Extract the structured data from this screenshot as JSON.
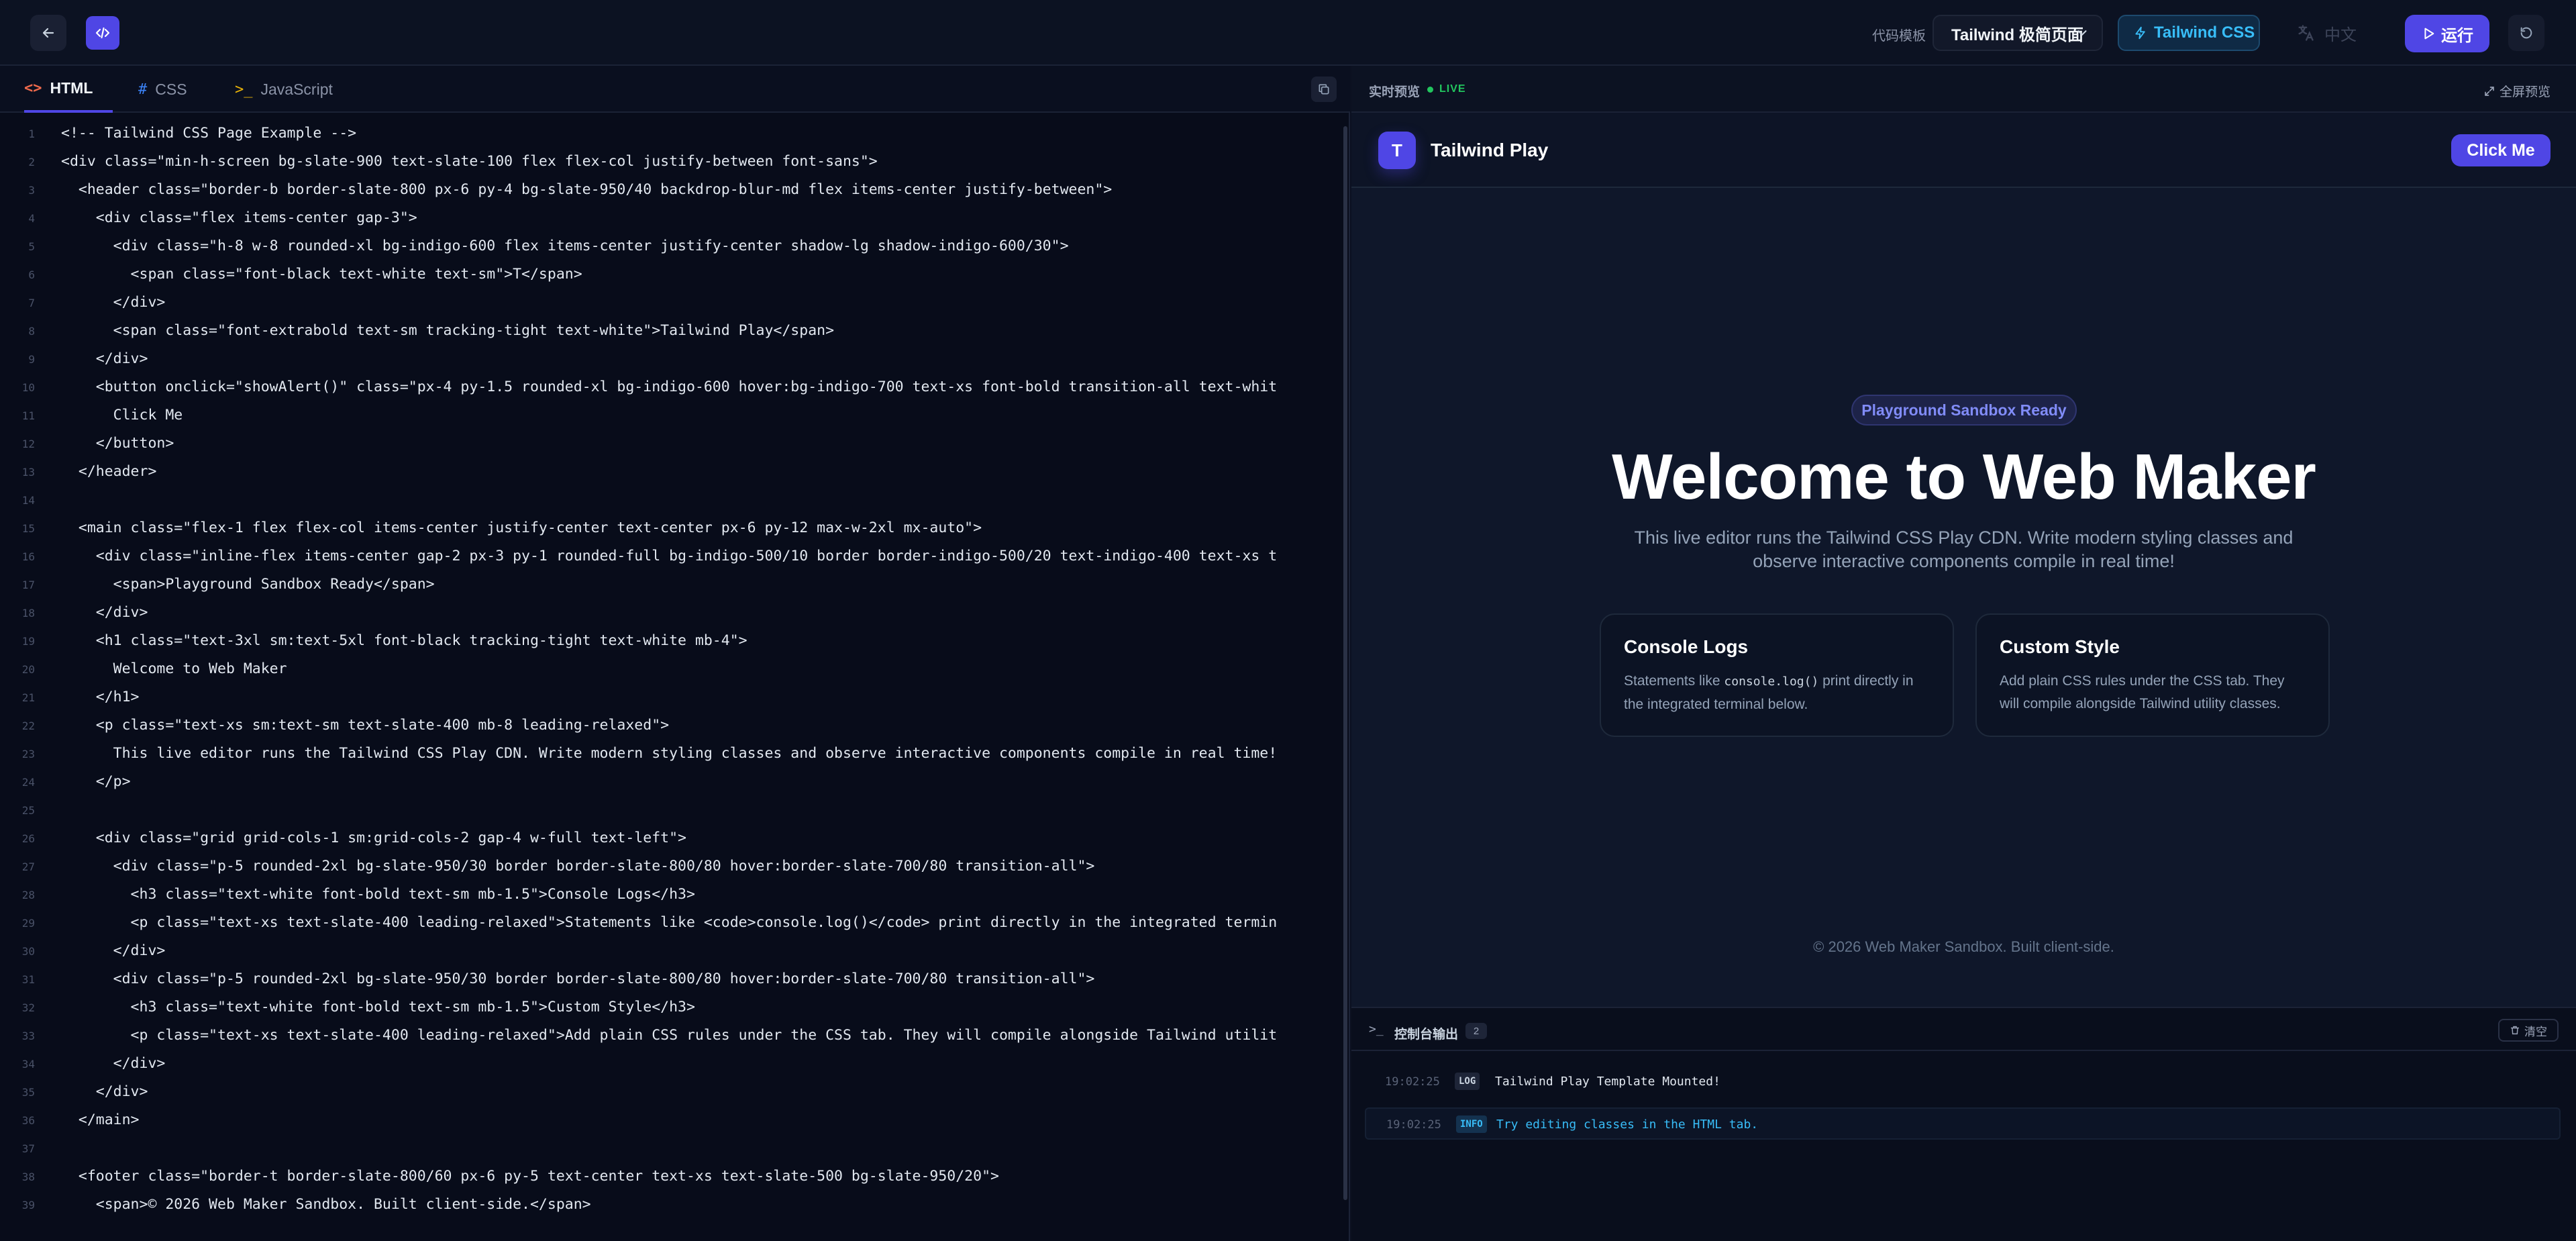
{
  "topbar": {
    "template_label": "代码模板",
    "template_value": "Tailwind 极简页面",
    "tailwind_badge": "Tailwind CSS",
    "language": "中文",
    "run_label": "运行"
  },
  "editor": {
    "tabs": [
      {
        "icon": "<>",
        "label": "HTML"
      },
      {
        "icon": "#",
        "label": "CSS"
      },
      {
        "icon": ">_",
        "label": "JavaScript"
      }
    ],
    "lines": [
      "<!-- Tailwind CSS Page Example -->",
      "<div class=\"min-h-screen bg-slate-900 text-slate-100 flex flex-col justify-between font-sans\">",
      "  <header class=\"border-b border-slate-800 px-6 py-4 bg-slate-950/40 backdrop-blur-md flex items-center justify-between\">",
      "    <div class=\"flex items-center gap-3\">",
      "      <div class=\"h-8 w-8 rounded-xl bg-indigo-600 flex items-center justify-center shadow-lg shadow-indigo-600/30\">",
      "        <span class=\"font-black text-white text-sm\">T</span>",
      "      </div>",
      "      <span class=\"font-extrabold text-sm tracking-tight text-white\">Tailwind Play</span>",
      "    </div>",
      "    <button onclick=\"showAlert()\" class=\"px-4 py-1.5 rounded-xl bg-indigo-600 hover:bg-indigo-700 text-xs font-bold transition-all text-whit",
      "      Click Me",
      "    </button>",
      "  </header>",
      "",
      "  <main class=\"flex-1 flex flex-col items-center justify-center text-center px-6 py-12 max-w-2xl mx-auto\">",
      "    <div class=\"inline-flex items-center gap-2 px-3 py-1 rounded-full bg-indigo-500/10 border border-indigo-500/20 text-indigo-400 text-xs t",
      "      <span>Playground Sandbox Ready</span>",
      "    </div>",
      "    <h1 class=\"text-3xl sm:text-5xl font-black tracking-tight text-white mb-4\">",
      "      Welcome to Web Maker",
      "    </h1>",
      "    <p class=\"text-xs sm:text-sm text-slate-400 mb-8 leading-relaxed\">",
      "      This live editor runs the Tailwind CSS Play CDN. Write modern styling classes and observe interactive components compile in real time!",
      "    </p>",
      "",
      "    <div class=\"grid grid-cols-1 sm:grid-cols-2 gap-4 w-full text-left\">",
      "      <div class=\"p-5 rounded-2xl bg-slate-950/30 border border-slate-800/80 hover:border-slate-700/80 transition-all\">",
      "        <h3 class=\"text-white font-bold text-sm mb-1.5\">Console Logs</h3>",
      "        <p class=\"text-xs text-slate-400 leading-relaxed\">Statements like <code>console.log()</code> print directly in the integrated termin",
      "      </div>",
      "      <div class=\"p-5 rounded-2xl bg-slate-950/30 border border-slate-800/80 hover:border-slate-700/80 transition-all\">",
      "        <h3 class=\"text-white font-bold text-sm mb-1.5\">Custom Style</h3>",
      "        <p class=\"text-xs text-slate-400 leading-relaxed\">Add plain CSS rules under the CSS tab. They will compile alongside Tailwind utilit",
      "      </div>",
      "    </div>",
      "  </main>",
      "",
      "  <footer class=\"border-t border-slate-800/60 px-6 py-5 text-center text-xs text-slate-500 bg-slate-950/20\">",
      "    <span>© 2026 Web Maker Sandbox. Built client-side.</span>"
    ]
  },
  "preview": {
    "title": "实时预览",
    "live_label": "LIVE",
    "fullscreen_label": "全屏预览",
    "app": {
      "logo_letter": "T",
      "name": "Tailwind Play",
      "button": "Click Me",
      "pill": "Playground Sandbox Ready",
      "heading": "Welcome to Web Maker",
      "subtitle": "This live editor runs the Tailwind CSS Play CDN. Write modern styling classes and observe interactive components compile in real time!",
      "cards": [
        {
          "title": "Console Logs",
          "text_before": "Statements like ",
          "code": "console.log()",
          "text_after": " print directly in the integrated terminal below."
        },
        {
          "title": "Custom Style",
          "text": "Add plain CSS rules under the CSS tab. They will compile alongside Tailwind utility classes."
        }
      ],
      "footer": "© 2026 Web Maker Sandbox. Built client-side."
    }
  },
  "console": {
    "prompt": ">_",
    "title": "控制台输出",
    "count": "2",
    "clear_label": "清空",
    "logs": [
      {
        "time": "19:02:25",
        "level": "LOG",
        "message": "Tailwind Play Template Mounted!"
      },
      {
        "time": "19:02:25",
        "level": "INFO",
        "message": "Try editing classes in the HTML tab."
      }
    ]
  },
  "colors": {
    "accent": "#4f46e5",
    "tailwind_blue": "#38bdf8",
    "live_green": "#22c55e",
    "background": "#0f172a"
  },
  "icons": [
    "back-arrow-icon",
    "code-icon",
    "chevron-down-icon",
    "lightning-icon",
    "translate-icon",
    "play-icon",
    "reset-icon",
    "copy-icon",
    "expand-icon",
    "terminal-icon",
    "trash-icon"
  ]
}
